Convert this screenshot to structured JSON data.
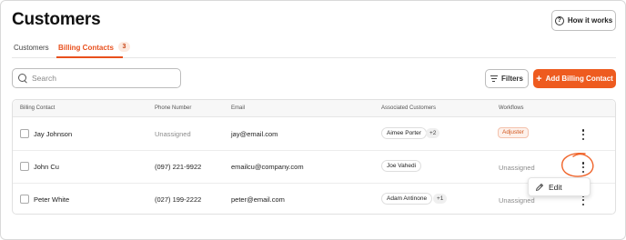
{
  "page": {
    "title": "Customers",
    "help_button": "How it works"
  },
  "tabs": [
    {
      "label": "Customers"
    },
    {
      "label": "Billing Contacts",
      "count": "3"
    }
  ],
  "toolbar": {
    "search_placeholder": "Search",
    "filters_label": "Filters",
    "add_label": "Add Billing Contact",
    "add_icon": "+"
  },
  "table": {
    "headers": [
      "Billing Contact",
      "Phone Number",
      "Email",
      "Associated Customers",
      "Workflows"
    ],
    "rows": [
      {
        "name": "Jay Johnson",
        "phone": "Unassigned",
        "email": "jay@email.com",
        "customer": "Aimee Porter",
        "more": "+2",
        "workflow": "Adjuster"
      },
      {
        "name": "John Cu",
        "phone": "(097) 221-9922",
        "email": "emailcu@company.com",
        "customer": "Joe Vahedi",
        "more": "",
        "workflow": "Unassigned"
      },
      {
        "name": "Peter White",
        "phone": "(027) 199-2222",
        "email": "peter@email.com",
        "customer": "Adam Antinone",
        "more": "+1",
        "workflow": "Unassigned"
      }
    ]
  },
  "row_menu": {
    "edit_label": "Edit"
  },
  "colors": {
    "accent": "#ee5b1f",
    "annotation": "#f0642a"
  }
}
